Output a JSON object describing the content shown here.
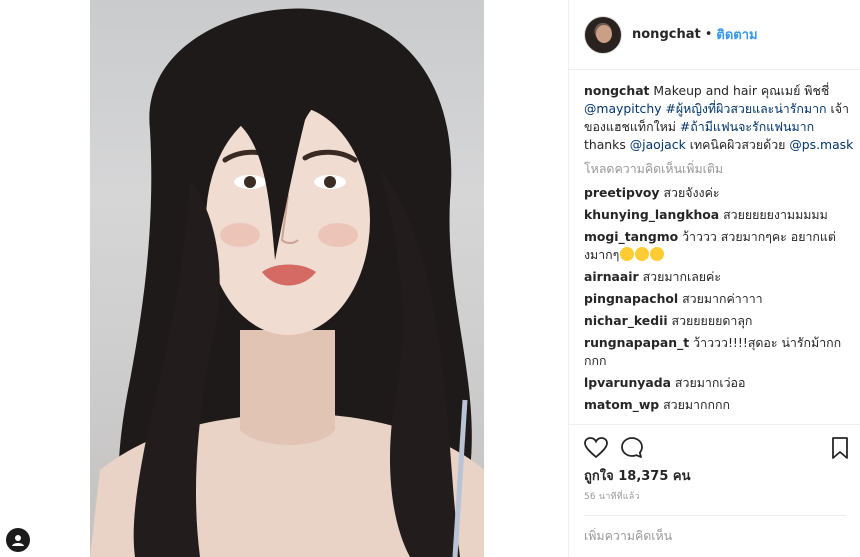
{
  "header": {
    "username": "nongchat",
    "separator": "•",
    "follow_label": "ติดตาม"
  },
  "caption": {
    "username": "nongchat",
    "text_1": " Makeup and hair คุณเมย์ พิชชี่ ",
    "mention_1": "@maypitchy",
    "space_1": " ",
    "hashtag_1": "#ผู้หญิงที่ผิวสวยและน่ารักมาก",
    "text_2": " เจ้าของแฮชแท็กใหม่ ",
    "hashtag_2": "#ถ้ามีแฟนจะรักแฟนมาก",
    "text_3": " thanks ",
    "mention_2": "@jaojack",
    "text_4": " เทคนิคผิวสวยด้วย ",
    "mention_3": "@ps.mask"
  },
  "load_more_label": "โหลดความคิดเห็นเพิ่มเติม",
  "comments": [
    {
      "username": "preetipvoy",
      "text": " สวยจังงค่ะ"
    },
    {
      "username": "khunying_langkhoa",
      "text": " สวยยยยยงามมมมม"
    },
    {
      "username": "mogi_tangmo",
      "text": " ว้าววว สวยมากๆคะ อยากแต่งมากๆ",
      "emojis": [
        "heart-eyes-emoji",
        "heart-eyes-emoji",
        "kissing-heart-emoji"
      ]
    },
    {
      "username": "airnaair",
      "text": " สวยมากเลยค่ะ"
    },
    {
      "username": "pingnapachol",
      "text": " สวยมากค่าาาา"
    },
    {
      "username": "nichar_kedii",
      "text": " สวยยยยยดาลุก"
    },
    {
      "username": "rungnapapan_t",
      "text": " ว้าววว!!!!สุดอะ น่ารักม้ากกกกก"
    },
    {
      "username": "lpvarunyada",
      "text": " สวยมากเว่ออ"
    },
    {
      "username": "matom_wp",
      "text": " สวยมากกกก"
    }
  ],
  "actions": {
    "like_icon": "heart-icon",
    "comment_icon": "comment-icon",
    "save_icon": "bookmark-icon"
  },
  "likes_text": "ถูกใจ 18,375 คน",
  "timestamp": "56 นาทีที่แล้ว",
  "add_comment_placeholder": "เพิ่มความคิดเห็น",
  "colors": {
    "link": "#003569",
    "follow": "#3897f0",
    "muted": "#999999",
    "text": "#262626"
  }
}
